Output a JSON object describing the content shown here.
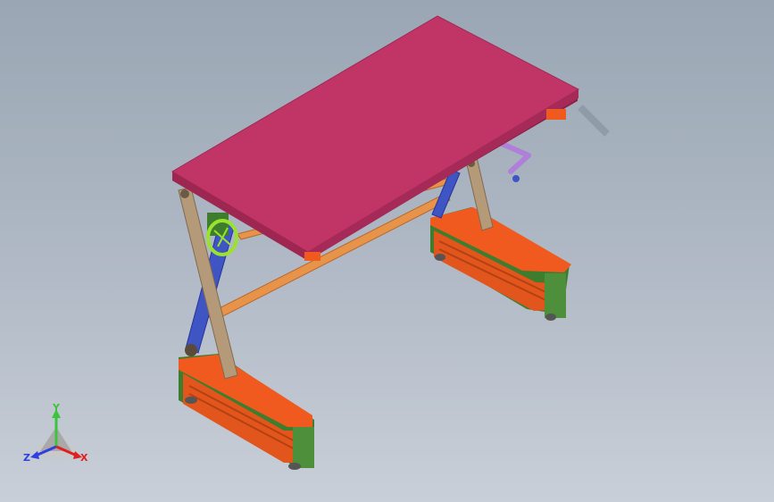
{
  "window": {
    "background_top": "#9aa6b4",
    "background_bottom": "#c9cfd8"
  },
  "model": {
    "colors": {
      "tabletop": "#c03566",
      "tabletop_edge": "#8e1f47",
      "legs": "#b59a7a",
      "scissor_arm": "#3f55c4",
      "crossbar": "#e8934a",
      "base_frame": "#f05a1e",
      "base_side": "#3e7d2e",
      "handwheel": "#9be22c",
      "crank": "#b07fd8"
    }
  },
  "triad": {
    "y_label": "Y",
    "z_label": "Z",
    "x_label": "X",
    "y_color": "#3cc43c",
    "z_color": "#2f3fe0",
    "x_color": "#e02020"
  }
}
